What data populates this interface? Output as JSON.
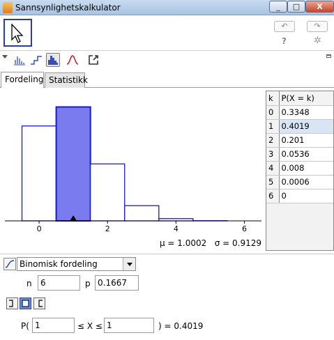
{
  "window": {
    "title": "Sannsynlighetskalkulator",
    "min_label": "_",
    "max_label": "□",
    "close_label": "X"
  },
  "toolbar": {
    "undo_label": "↶",
    "redo_label": "↷",
    "help_label": "?",
    "settings_label": "✲"
  },
  "tabs": [
    {
      "label": "Fordeling",
      "active": true
    },
    {
      "label": "Statistikk",
      "active": false
    }
  ],
  "chart_data": {
    "type": "bar",
    "categories": [
      0,
      1,
      2,
      3,
      4,
      5,
      6
    ],
    "values": [
      0.3348,
      0.4019,
      0.201,
      0.0536,
      0.008,
      0.0006,
      0
    ],
    "highlighted": [
      1
    ],
    "xticks": [
      "0",
      "2",
      "4",
      "6"
    ],
    "xlim": [
      -1,
      6.5
    ],
    "ylim": [
      0,
      0.44
    ],
    "marker_at": 1,
    "colors": {
      "bar_edge": "#1a1acc",
      "bar_fill": "#ffffff",
      "highlight_fill": "#7b7bf0"
    }
  },
  "stats": {
    "mu_label": "μ = 1.0002",
    "sigma_label": "σ = 0.9129"
  },
  "table": {
    "header_k": "k",
    "header_p": "P(X = k)",
    "rows": [
      {
        "k": "0",
        "p": "0.3348"
      },
      {
        "k": "1",
        "p": "0.4019"
      },
      {
        "k": "2",
        "p": "0.201"
      },
      {
        "k": "3",
        "p": "0.0536"
      },
      {
        "k": "4",
        "p": "0.008"
      },
      {
        "k": "5",
        "p": "0.0006"
      },
      {
        "k": "6",
        "p": "0"
      }
    ],
    "selected_row": 1
  },
  "controls": {
    "distribution": "Binomisk fordeling",
    "n_label": "n",
    "n_value": "6",
    "p_label": "p",
    "p_value": "0.1667",
    "prob_prefix": "P(",
    "lower_value": "1",
    "middle_label": "≤ X ≤",
    "upper_value": "1",
    "result_label": ") =  0.4019"
  }
}
